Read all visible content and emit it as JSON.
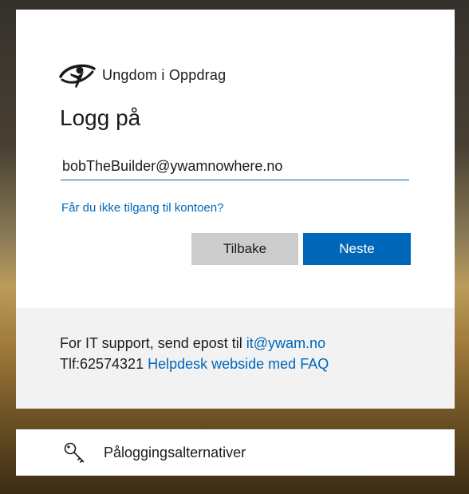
{
  "logo": {
    "text": "Ungdom i Oppdrag",
    "icon": "organization-logo-icon"
  },
  "title": "Logg på",
  "email": {
    "value": "bobTheBuilder@ywamnowhere.no"
  },
  "links": {
    "no_access": "Får du ikke tilgang til kontoen?"
  },
  "buttons": {
    "back": "Tilbake",
    "next": "Neste"
  },
  "footer": {
    "line1_prefix": "For IT support, send epost til ",
    "email_link": "it@ywam.no",
    "line2_prefix": "Tlf:62574321 ",
    "helpdesk_link": "Helpdesk webside med FAQ"
  },
  "sign_in_options": {
    "label": "Påloggingsalternativer",
    "icon": "key-icon"
  },
  "colors": {
    "accent": "#0067b8",
    "secondary_button": "#cccccc",
    "footer_background": "#f2f2f2"
  }
}
